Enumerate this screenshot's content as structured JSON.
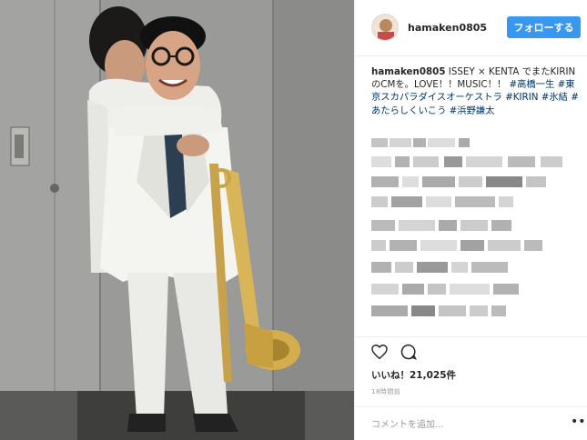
{
  "post": {
    "username": "hamaken0805",
    "follow_label": "フォローする",
    "caption_user": "hamaken0805",
    "caption_text": " ISSEY × KENTA でまたKIRINのCMを。LOVE！！MUSIC！！ ",
    "tags": [
      "#高橋一生",
      "#東京スカパラダイスオーケストラ",
      "#KIRIN",
      "#氷結",
      "#あたらしくいこう",
      "#浜野謙太"
    ],
    "likes_label": "いいね！21,025件",
    "time_ago": "18時間前",
    "comment_placeholder": "コメントを追加...",
    "more_symbol": "•••"
  },
  "icons": [
    "heart-icon",
    "comment-icon",
    "more-options-icon"
  ],
  "colors": {
    "follow_button": "#3897f0",
    "hashtag": "#003569"
  }
}
